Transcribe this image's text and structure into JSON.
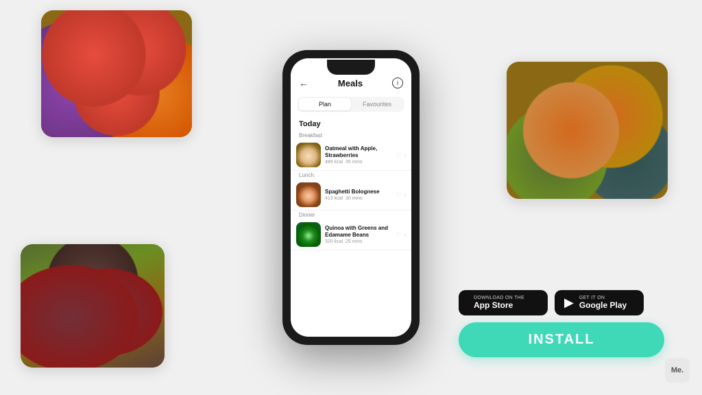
{
  "app": {
    "background_color": "#f0f0f0"
  },
  "phone": {
    "header": {
      "back_label": "←",
      "title": "Meals",
      "info_label": "i"
    },
    "tabs": [
      {
        "label": "Plan",
        "active": true
      },
      {
        "label": "Favourites",
        "active": false
      }
    ],
    "section_title": "Today",
    "meals": [
      {
        "category": "Breakfast",
        "name": "Oatmeal with Apple, Strawberries",
        "kcal": "489 kcal",
        "time": "35 mins",
        "bowl_type": "oatmeal"
      },
      {
        "category": "Lunch",
        "name": "Spaghetti Bolognese",
        "kcal": "413 kcal",
        "time": "30 mins",
        "bowl_type": "spaghetti"
      },
      {
        "category": "Dinner",
        "name": "Quinoa with Greens and Edamame Beans",
        "kcal": "320 kcal",
        "time": "25 mins",
        "bowl_type": "quinoa"
      }
    ]
  },
  "cta": {
    "app_store": {
      "sub_label": "Download on the",
      "main_label": "App Store"
    },
    "google_play": {
      "sub_label": "GET IT ON",
      "main_label": "Google Play"
    },
    "install_label": "INSTALL"
  },
  "me_logo": "Me."
}
